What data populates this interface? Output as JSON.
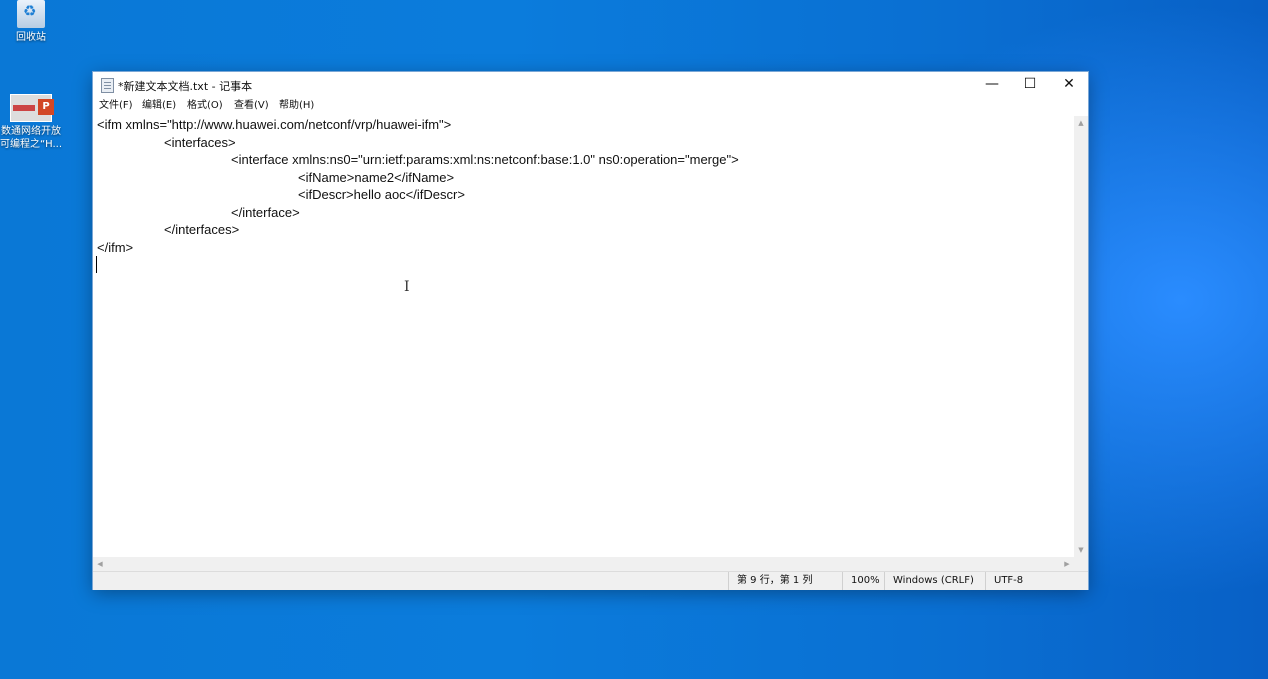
{
  "desktop": {
    "icons": [
      {
        "label": "回收站"
      },
      {
        "label_line1": "数通网络开放",
        "label_line2": "可编程之“H..."
      }
    ],
    "ppt_badge": "P"
  },
  "window": {
    "title": "*新建文本文档.txt - 记事本",
    "controls": {
      "minimize": "—",
      "maximize": "☐",
      "close": "✕"
    },
    "menu": [
      "文件(F)",
      "编辑(E)",
      "格式(O)",
      "查看(V)",
      "帮助(H)"
    ]
  },
  "editor": {
    "lines": [
      "<ifm xmlns=\"http://www.huawei.com/netconf/vrp/huawei-ifm\">",
      "<interfaces>",
      "<interface xmlns:ns0=\"urn:ietf:params:xml:ns:netconf:base:1.0\" ns0:operation=\"merge\">",
      "<ifName>name2</ifName>",
      "<ifDescr>hello aoc</ifDescr>",
      "</interface>",
      "</interfaces>",
      "</ifm>"
    ]
  },
  "status": {
    "position": "第 9 行，第 1 列",
    "zoom": "100%",
    "line_ending": "Windows (CRLF)",
    "encoding": "UTF-8"
  },
  "colors": {
    "desktop_blue": "#0a78d6",
    "window_border": "#7aa7d6"
  }
}
